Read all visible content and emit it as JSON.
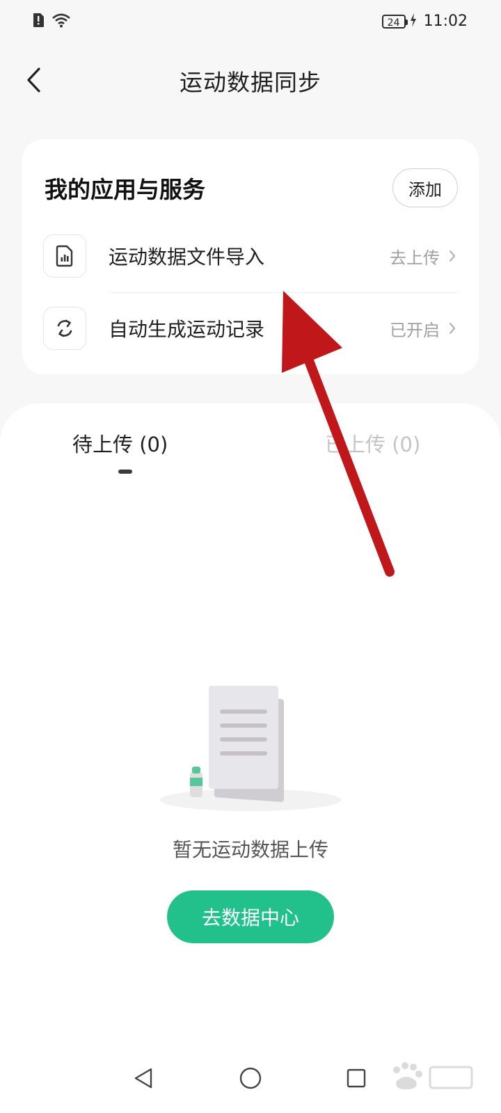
{
  "status_bar": {
    "battery_level": "24",
    "time": "11:02"
  },
  "header": {
    "title": "运动数据同步"
  },
  "services": {
    "title": "我的应用与服务",
    "add_label": "添加",
    "items": [
      {
        "label": "运动数据文件导入",
        "status": "去上传",
        "icon": "file-chart-icon"
      },
      {
        "label": "自动生成运动记录",
        "status": "已开启",
        "icon": "sync-icon"
      }
    ]
  },
  "tabs": [
    {
      "label": "待上传 (0)",
      "active": true
    },
    {
      "label": "已上传 (0)",
      "active": false
    }
  ],
  "empty_state": {
    "message": "暂无运动数据上传",
    "button_label": "去数据中心"
  },
  "colors": {
    "accent": "#22c08a",
    "annotation": "#c0171a"
  }
}
